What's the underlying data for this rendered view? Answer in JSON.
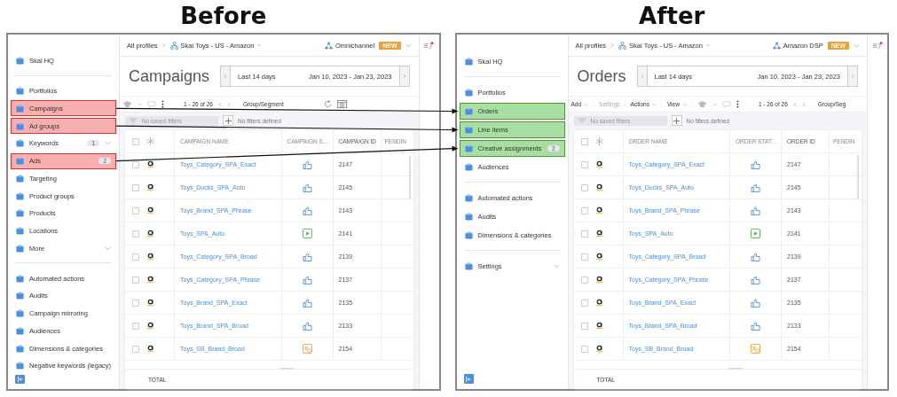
{
  "panels": [
    {
      "heading": "Before",
      "kind": "before",
      "sidebar": {
        "sections": [
          [
            {
              "label": "Skai HQ",
              "highlighted": false
            }
          ],
          [
            {
              "label": "Portfolios",
              "highlighted": false
            },
            {
              "label": "Campaigns",
              "highlighted": true
            },
            {
              "label": "Ad groups",
              "highlighted": true
            },
            {
              "label": "Keywords",
              "highlighted": false,
              "badge": "1",
              "expandable": true
            },
            {
              "label": "Ads",
              "highlighted": true,
              "badge": "2"
            },
            {
              "label": "Targeting",
              "highlighted": false
            },
            {
              "label": "Product groups",
              "highlighted": false
            },
            {
              "label": "Products",
              "highlighted": false
            },
            {
              "label": "Locations",
              "highlighted": false
            },
            {
              "label": "More",
              "highlighted": false,
              "expandable": true
            }
          ],
          [
            {
              "label": "Automated actions",
              "highlighted": false
            },
            {
              "label": "Audits",
              "highlighted": false
            },
            {
              "label": "Campaign mirroring",
              "highlighted": false
            },
            {
              "label": "Audiences",
              "highlighted": false
            },
            {
              "label": "Dimensions & categories",
              "highlighted": false
            },
            {
              "label": "Negative keywords (legacy)",
              "highlighted": false
            }
          ]
        ]
      },
      "topbar": {
        "breadcrumb": "All profiles",
        "profile": "Skai Toys - US - Amazon",
        "channel": "Omnichannel",
        "badge": "NEW"
      },
      "title": "Campaigns",
      "date_preset": "Last 14 days",
      "date_range": "Jan 10, 2023 - Jan 23, 2023",
      "toolbar": {
        "pagination": "1 - 26 of 26",
        "group_select": "Group/Segment",
        "refresh": true
      },
      "filters": {
        "saved": "No saved filters",
        "defined": "No filters defined"
      },
      "table": {
        "all_checked": false,
        "columns": [
          "CAMPAIGN NAME",
          "CAMPAIGN S…",
          "CAMPAIGN ID",
          "PENDIN"
        ],
        "rows": [
          {
            "name": "Toys_Category_SPA_Exact",
            "kind": "approved",
            "id": "2147",
            "checked": false
          },
          {
            "name": "Toys_Ducks_SPA_Auto",
            "kind": "approved",
            "id": "2145",
            "checked": false
          },
          {
            "name": "Toys_Brand_SPA_Phrase",
            "kind": "approved",
            "id": "2143",
            "checked": false
          },
          {
            "name": "Toys_SPA_Auto",
            "kind": "running",
            "id": "2141",
            "checked": false
          },
          {
            "name": "Toys_Category_SPA_Broad",
            "kind": "approved",
            "id": "2139",
            "checked": false
          },
          {
            "name": "Toys_Category_SPA_Phrase",
            "kind": "approved",
            "id": "2137",
            "checked": false
          },
          {
            "name": "Toys_Brand_SPA_Exact",
            "kind": "approved",
            "id": "2135",
            "checked": false
          },
          {
            "name": "Toys_Brand_SPA_Broad",
            "kind": "approved",
            "id": "2133",
            "checked": false
          },
          {
            "name": "Toys_SB_Brand_Broad",
            "kind": "paused",
            "id": "2154",
            "checked": false
          }
        ],
        "total": "TOTAL"
      }
    },
    {
      "heading": "After",
      "kind": "after",
      "sidebar": {
        "sections": [
          [
            {
              "label": "Skai HQ",
              "highlighted": false
            }
          ],
          [
            {
              "label": "Portfolios",
              "highlighted": false
            },
            {
              "label": "Orders",
              "highlighted": true
            },
            {
              "label": "Line items",
              "highlighted": true
            },
            {
              "label": "Creative assignments",
              "highlighted": true,
              "badge": "2"
            },
            {
              "label": "Audiences",
              "highlighted": false
            }
          ],
          [
            {
              "label": "Automated actions",
              "highlighted": false
            },
            {
              "label": "Audits",
              "highlighted": false
            },
            {
              "label": "Dimensions & categories",
              "highlighted": false
            }
          ],
          [
            {
              "label": "Settings",
              "highlighted": false,
              "expandable": true
            }
          ]
        ]
      },
      "topbar": {
        "breadcrumb": "All profiles",
        "profile": "Skai Toys - US - Amazon",
        "channel": "Amazon DSP",
        "badge": "NEW"
      },
      "title": "Orders",
      "date_preset": "Last 14 days",
      "date_range": "Jan 10, 2023 - Jan 23, 2023",
      "toolbar": {
        "buttons": [
          {
            "label": "Add",
            "caret": true,
            "disabled": false
          },
          {
            "label": "Settings",
            "caret": false,
            "disabled": true
          },
          {
            "label": "Actions",
            "caret": true,
            "disabled": false
          },
          {
            "label": "View",
            "caret": true,
            "disabled": false
          }
        ],
        "pagination": "1 - 26 of 26",
        "group_select": "Group/Seg",
        "refresh": false
      },
      "filters": {
        "saved": "No saved filters",
        "defined": "No filters defined"
      },
      "table": {
        "all_checked": false,
        "columns": [
          "ORDER NAME",
          "ORDER STAT…",
          "ORDER ID",
          "PENDIN"
        ],
        "rows": [
          {
            "name": "Toys_Category_SPA_Exact",
            "kind": "approved",
            "id": "2147",
            "checked": false
          },
          {
            "name": "Toys_Ducks_SPA_Auto",
            "kind": "approved",
            "id": "2145",
            "checked": false
          },
          {
            "name": "Toys_Brand_SPA_Phrase",
            "kind": "approved",
            "id": "2143",
            "checked": false
          },
          {
            "name": "Toys_SPA_Auto",
            "kind": "running",
            "id": "2141",
            "checked": false
          },
          {
            "name": "Toys_Category_SPA_Broad",
            "kind": "approved",
            "id": "2139",
            "checked": false
          },
          {
            "name": "Toys_Category_SPA_Phrase",
            "kind": "approved",
            "id": "2137",
            "checked": false
          },
          {
            "name": "Toys_Brand_SPA_Exact",
            "kind": "approved",
            "id": "2135",
            "checked": false
          },
          {
            "name": "Toys_Brand_SPA_Broad",
            "kind": "approved",
            "id": "2133",
            "checked": false
          },
          {
            "name": "Toys_SB_Brand_Broad",
            "kind": "paused",
            "id": "2154",
            "checked": false
          }
        ],
        "total": "TOTAL"
      }
    }
  ]
}
